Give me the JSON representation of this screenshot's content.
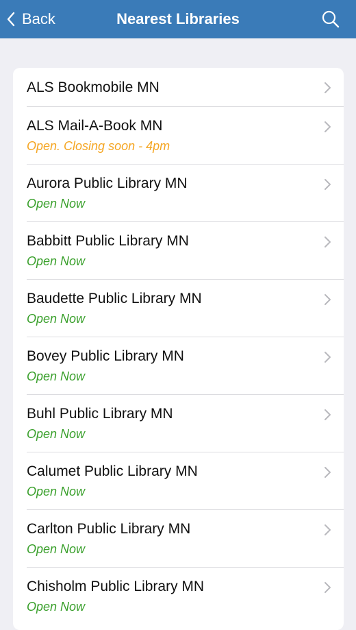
{
  "navbar": {
    "back_label": "Back",
    "title": "Nearest Libraries",
    "search_icon": "search-icon"
  },
  "colors": {
    "navbar": "#3a7bb8",
    "open": "#3aa02c",
    "closing_soon": "#f5a623",
    "background": "#efeff4"
  },
  "libraries": [
    {
      "name": "ALS Bookmobile MN",
      "status": "",
      "status_type": "none"
    },
    {
      "name": "ALS Mail-A-Book MN",
      "status": "Open. Closing soon - 4pm",
      "status_type": "closing_soon"
    },
    {
      "name": "Aurora Public Library MN",
      "status": "Open Now",
      "status_type": "open"
    },
    {
      "name": "Babbitt Public Library MN",
      "status": "Open Now",
      "status_type": "open"
    },
    {
      "name": "Baudette Public Library MN",
      "status": "Open Now",
      "status_type": "open"
    },
    {
      "name": "Bovey Public Library MN",
      "status": "Open Now",
      "status_type": "open"
    },
    {
      "name": "Buhl Public Library MN",
      "status": "Open Now",
      "status_type": "open"
    },
    {
      "name": "Calumet Public Library MN",
      "status": "Open Now",
      "status_type": "open"
    },
    {
      "name": "Carlton Public Library MN",
      "status": "Open Now",
      "status_type": "open"
    },
    {
      "name": "Chisholm Public Library MN",
      "status": "Open Now",
      "status_type": "open"
    }
  ]
}
